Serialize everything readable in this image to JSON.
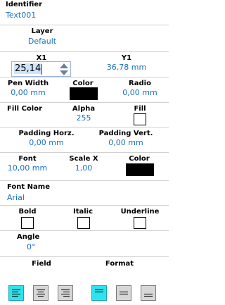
{
  "identifier": {
    "label": "Identifier",
    "value": "Text001"
  },
  "layer": {
    "label": "Layer",
    "value": "Default"
  },
  "x1": {
    "label": "X1",
    "value": "25,14"
  },
  "y1": {
    "label": "Y1",
    "value": "36,78 mm"
  },
  "pen_width": {
    "label": "Pen Width",
    "value": "0,00 mm"
  },
  "color1": {
    "label": "Color",
    "color": "#000000"
  },
  "radio": {
    "label": "Radio",
    "value": "0,00 mm"
  },
  "fill_color": {
    "label": "Fill Color"
  },
  "alpha": {
    "label": "Alpha",
    "value": "255"
  },
  "fill": {
    "label": "Fill"
  },
  "padding_horz": {
    "label": "Padding Horz.",
    "value": "0,00 mm"
  },
  "padding_vert": {
    "label": "Padding Vert.",
    "value": "0,00 mm"
  },
  "font": {
    "label": "Font",
    "value": "10,00 mm"
  },
  "scale_x": {
    "label": "Scale X",
    "value": "1,00"
  },
  "color2": {
    "label": "Color",
    "color": "#000000"
  },
  "font_name": {
    "label": "Font Name",
    "value": "Arial"
  },
  "bold": {
    "label": "Bold"
  },
  "italic": {
    "label": "Italic"
  },
  "underline": {
    "label": "Underline"
  },
  "angle": {
    "label": "Angle",
    "value": "0°"
  },
  "field": {
    "label": "Field",
    "buttons": [
      "align-left",
      "align-center",
      "align-right"
    ],
    "active": "align-left"
  },
  "format": {
    "label": "Format",
    "buttons": [
      "align-top",
      "align-middle",
      "align-bottom"
    ],
    "active": "align-top"
  },
  "colors": {
    "accent": "#1a6fc4",
    "active_button": "#2fe3ee",
    "button": "#d7d7d7"
  }
}
